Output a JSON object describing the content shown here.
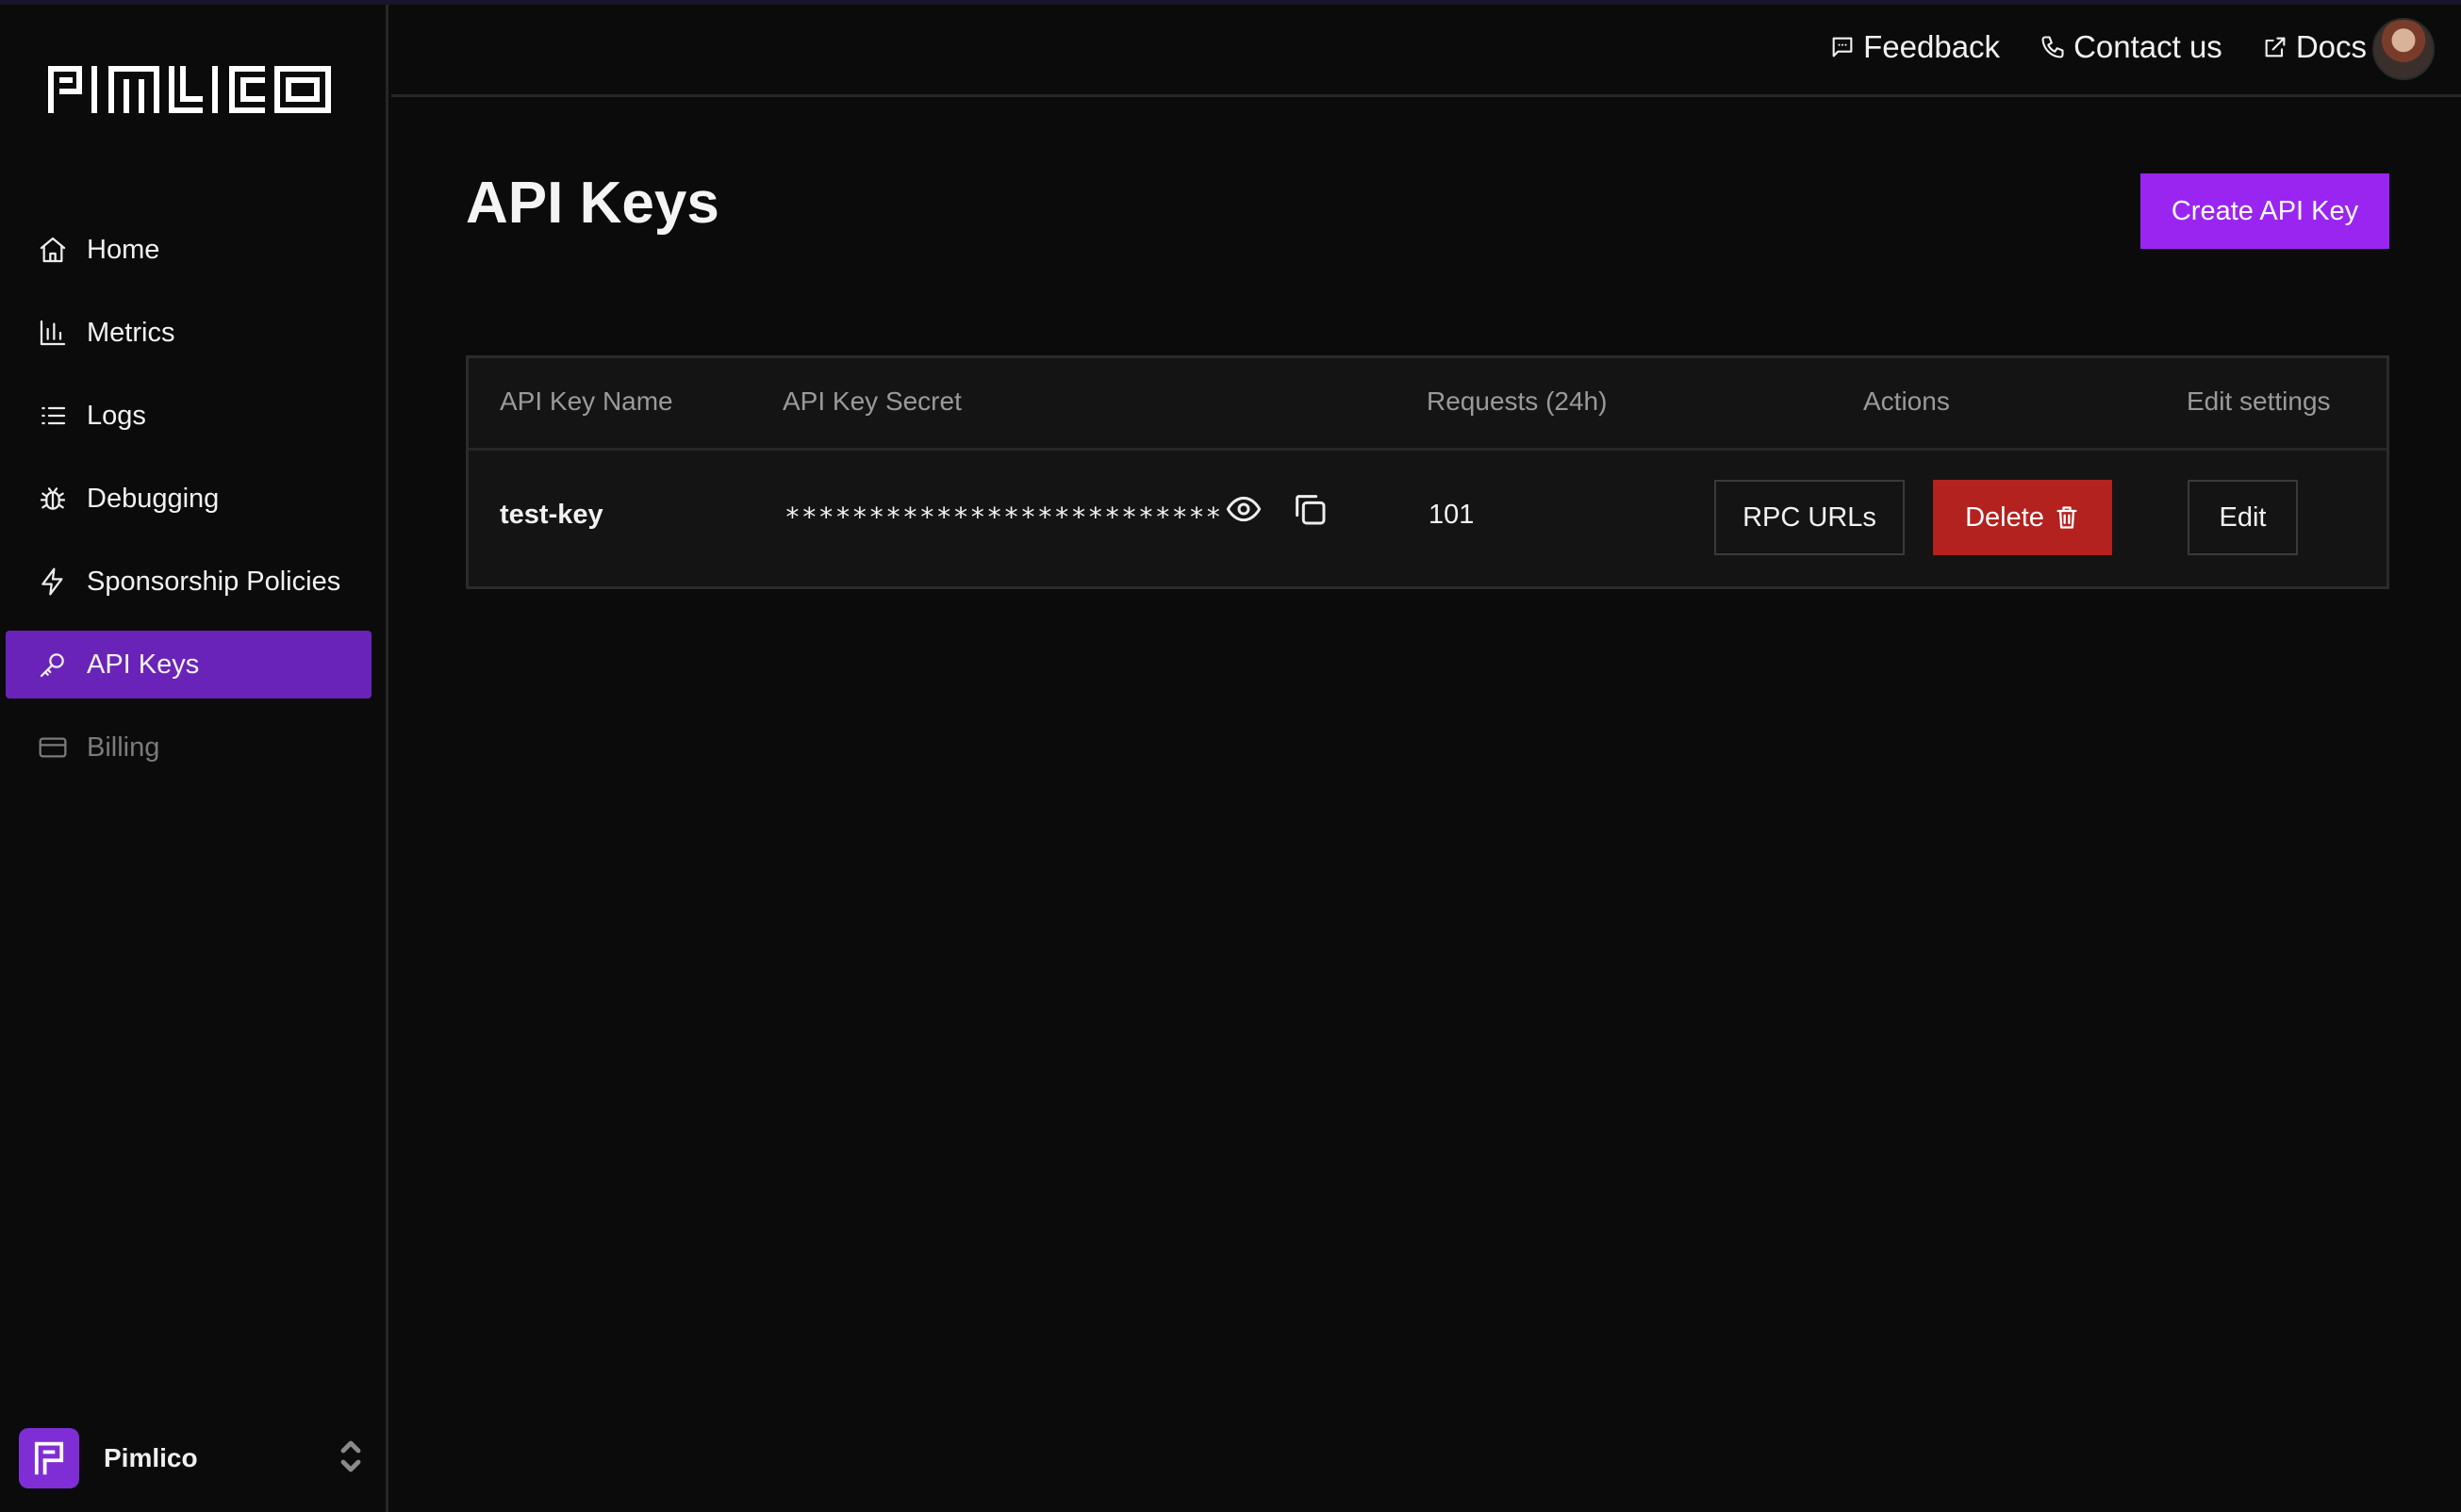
{
  "brand": {
    "logo_text": "PIMLICO"
  },
  "sidebar": {
    "items": [
      {
        "label": "Home",
        "icon": "home-icon"
      },
      {
        "label": "Metrics",
        "icon": "bar-chart-icon"
      },
      {
        "label": "Logs",
        "icon": "list-icon"
      },
      {
        "label": "Debugging",
        "icon": "bug-icon"
      },
      {
        "label": "Sponsorship Policies",
        "icon": "lightning-icon"
      },
      {
        "label": "API Keys",
        "icon": "key-icon",
        "active": true
      },
      {
        "label": "Billing",
        "icon": "credit-card-icon",
        "disabled": true
      }
    ],
    "org": {
      "name": "Pimlico"
    }
  },
  "topbar": {
    "feedback": "Feedback",
    "contact": "Contact us",
    "docs": "Docs"
  },
  "main": {
    "title": "API Keys",
    "create_button": "Create API Key",
    "table": {
      "headers": [
        "API Key Name",
        "API Key Secret",
        "Requests (24h)",
        "Actions",
        "Edit settings"
      ],
      "rows": [
        {
          "name": "test-key",
          "secret": "**************************",
          "requests": "101",
          "rpc_label": "RPC URLs",
          "delete_label": "Delete",
          "edit_label": "Edit"
        }
      ]
    }
  },
  "colors": {
    "accent": "#9a25f0",
    "active_nav": "#6a23b8",
    "danger": "#b3221f",
    "background": "#0b0b0b"
  }
}
